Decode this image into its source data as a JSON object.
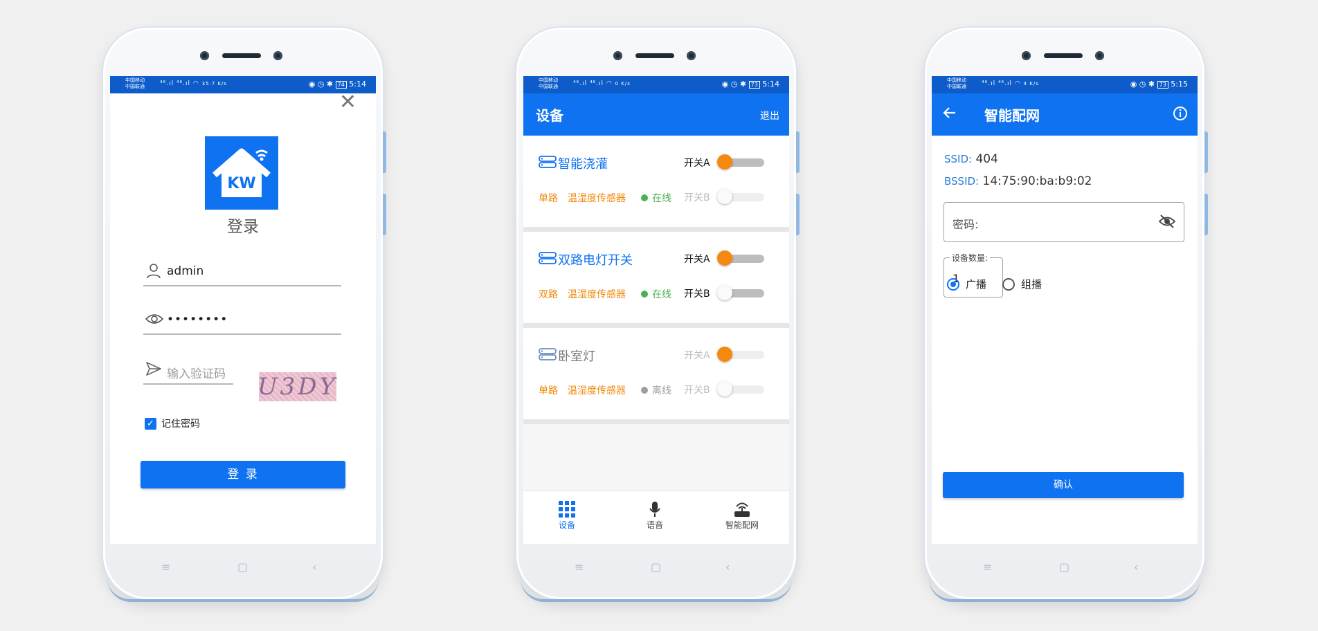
{
  "colors": {
    "primary": "#0f72f1",
    "status_bar": "#0d5cc9",
    "tag_orange": "#f08a0c",
    "switch_on": "#f5890f",
    "online_green": "#4caf50",
    "offline_gray": "#9e9e9e"
  },
  "phones": [
    {
      "status": {
        "carrier_1": "中国移动",
        "carrier_2": "中国联通",
        "signal": "⁴⁶.ıl ⁴⁶.ıl ◠",
        "speed": "35.7 K/s",
        "icons": "◉ ◷ ✱",
        "battery": "74",
        "time": "5:14"
      },
      "login": {
        "close_icon": "close-icon",
        "logo_text": "KW",
        "title": "登录",
        "username": "admin",
        "password": "••••••••",
        "captcha_placeholder": "输入验证码",
        "captcha_text": "U3DY",
        "remember_label": "记住密码",
        "remember_checked": true,
        "login_button": "登 录"
      }
    },
    {
      "status": {
        "carrier_1": "中国移动",
        "carrier_2": "中国联通",
        "signal": "⁴⁶.ıl ⁴⁶.ıl ◠",
        "speed": "0 K/s",
        "icons": "◉ ◷ ✱",
        "battery": "73",
        "time": "5:14"
      },
      "devices": {
        "title": "设备",
        "logout": "退出",
        "items": [
          {
            "name": "智能浇灌",
            "enabled": true,
            "tag1": "单路",
            "tag2": "温湿度传感器",
            "status": "在线",
            "online": true,
            "switch_a_label": "开关A",
            "switch_a_on": true,
            "switch_a_enabled": true,
            "switch_b_label": "开关B",
            "switch_b_on": false,
            "switch_b_enabled": false
          },
          {
            "name": "双路电灯开关",
            "enabled": true,
            "tag1": "双路",
            "tag2": "温湿度传感器",
            "status": "在线",
            "online": true,
            "switch_a_label": "开关A",
            "switch_a_on": true,
            "switch_a_enabled": true,
            "switch_b_label": "开关B",
            "switch_b_on": false,
            "switch_b_enabled": true
          },
          {
            "name": "卧室灯",
            "enabled": false,
            "tag1": "单路",
            "tag2": "温湿度传感器",
            "status": "离线",
            "online": false,
            "switch_a_label": "开关A",
            "switch_a_on": true,
            "switch_a_enabled": false,
            "switch_b_label": "开关B",
            "switch_b_on": false,
            "switch_b_enabled": false
          }
        ],
        "nav": [
          {
            "label": "设备",
            "icon": "grid-icon",
            "active": true
          },
          {
            "label": "语音",
            "icon": "microphone-icon",
            "active": false
          },
          {
            "label": "智能配网",
            "icon": "router-icon",
            "active": false
          }
        ]
      }
    },
    {
      "status": {
        "carrier_1": "中国移动",
        "carrier_2": "中国联通",
        "signal": "⁴⁶.ıl ⁴⁶.ıl ◠",
        "speed": "4 K/s",
        "icons": "◉ ◷ ✱",
        "battery": "73",
        "time": "5:15"
      },
      "network": {
        "title": "智能配网",
        "ssid_label": "SSID:",
        "ssid_value": "404",
        "bssid_label": "BSSID:",
        "bssid_value": "14:75:90:ba:b9:02",
        "password_label": "密码:",
        "count_label": "设备数量:",
        "count_value": "1",
        "radio_broadcast": "广播",
        "radio_multicast": "组播",
        "selected": "broadcast",
        "confirm_button": "确认"
      }
    }
  ]
}
